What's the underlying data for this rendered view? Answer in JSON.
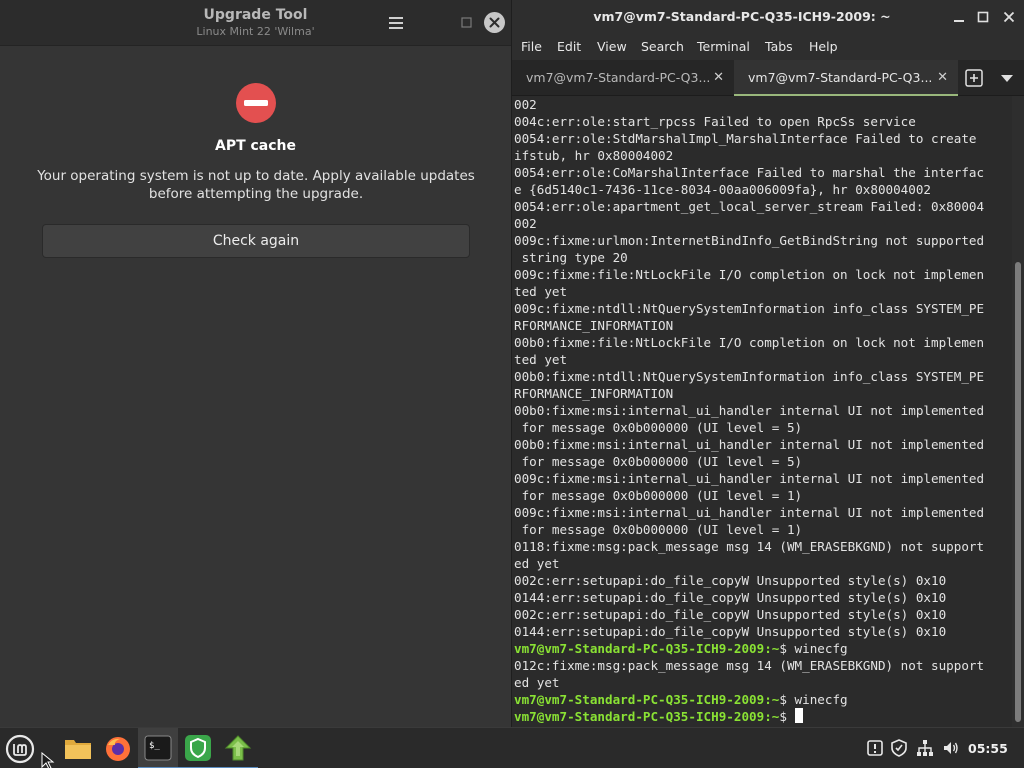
{
  "upgrade_tool": {
    "title": "Upgrade Tool",
    "subtitle": "Linux Mint 22 'Wilma'",
    "heading": "APT cache",
    "message": "Your operating system is not up to date. Apply available updates before attempting the upgrade.",
    "check_again_label": "Check again",
    "error_color": "#e35050"
  },
  "terminal": {
    "title": "vm7@vm7-Standard-PC-Q35-ICH9-2009: ~",
    "menu": [
      "File",
      "Edit",
      "View",
      "Search",
      "Terminal",
      "Tabs",
      "Help"
    ],
    "tabs": [
      {
        "label": "vm7@vm7-Standard-PC-Q3...",
        "active": false
      },
      {
        "label": "vm7@vm7-Standard-PC-Q3...",
        "active": true
      }
    ],
    "prompt": "vm7@vm7-Standard-PC-Q35-ICH9-2009:~",
    "prompt_color": "#8ae234",
    "lines": [
      "002",
      "004c:err:ole:start_rpcss Failed to open RpcSs service",
      "0054:err:ole:StdMarshalImpl_MarshalInterface Failed to create",
      "ifstub, hr 0x80004002",
      "0054:err:ole:CoMarshalInterface Failed to marshal the interfac",
      "e {6d5140c1-7436-11ce-8034-00aa006009fa}, hr 0x80004002",
      "0054:err:ole:apartment_get_local_server_stream Failed: 0x80004",
      "002",
      "009c:fixme:urlmon:InternetBindInfo_GetBindString not supported",
      " string type 20",
      "009c:fixme:file:NtLockFile I/O completion on lock not implemen",
      "ted yet",
      "009c:fixme:ntdll:NtQuerySystemInformation info_class SYSTEM_PE",
      "RFORMANCE_INFORMATION",
      "00b0:fixme:file:NtLockFile I/O completion on lock not implemen",
      "ted yet",
      "00b0:fixme:ntdll:NtQuerySystemInformation info_class SYSTEM_PE",
      "RFORMANCE_INFORMATION",
      "00b0:fixme:msi:internal_ui_handler internal UI not implemented",
      " for message 0x0b000000 (UI level = 5)",
      "00b0:fixme:msi:internal_ui_handler internal UI not implemented",
      " for message 0x0b000000 (UI level = 5)",
      "009c:fixme:msi:internal_ui_handler internal UI not implemented",
      " for message 0x0b000000 (UI level = 1)",
      "009c:fixme:msi:internal_ui_handler internal UI not implemented",
      " for message 0x0b000000 (UI level = 1)",
      "0118:fixme:msg:pack_message msg 14 (WM_ERASEBKGND) not support",
      "ed yet",
      "002c:err:setupapi:do_file_copyW Unsupported style(s) 0x10",
      "0144:err:setupapi:do_file_copyW Unsupported style(s) 0x10",
      "002c:err:setupapi:do_file_copyW Unsupported style(s) 0x10",
      "0144:err:setupapi:do_file_copyW Unsupported style(s) 0x10",
      {
        "prompt": true,
        "cmd": "winecfg"
      },
      "012c:fixme:msg:pack_message msg 14 (WM_ERASEBKGND) not support",
      "ed yet",
      {
        "prompt": true,
        "cmd": "winecfg"
      },
      {
        "prompt": true,
        "cmd": "",
        "cursor": true
      }
    ]
  },
  "taskbar": {
    "apps": [
      {
        "name": "menu",
        "icon": "linux-mint-menu-icon"
      },
      {
        "name": "files",
        "icon": "folder-icon"
      },
      {
        "name": "firefox",
        "icon": "firefox-icon"
      },
      {
        "name": "terminal",
        "icon": "terminal-icon"
      },
      {
        "name": "update-manager",
        "icon": "shield-icon"
      },
      {
        "name": "upgrade-tool",
        "icon": "upgrade-arrow-icon"
      }
    ],
    "clock": "05:55"
  }
}
